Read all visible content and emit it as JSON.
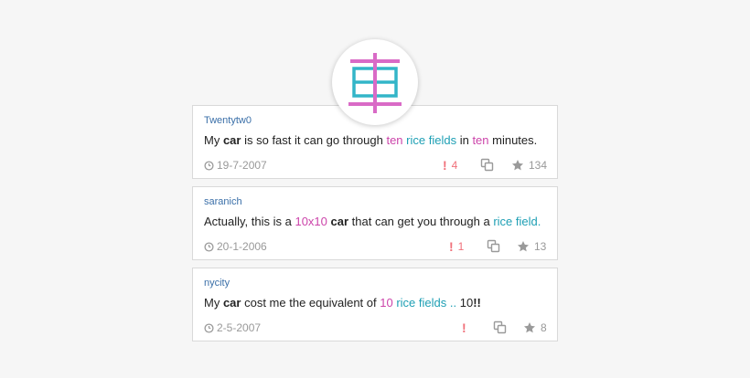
{
  "mnemonic": {
    "character": "車",
    "colors": {
      "pink": "#d96ac6",
      "teal": "#33b5c8"
    }
  },
  "mnemonics": [
    {
      "author": "Twentytw0",
      "sentence": [
        {
          "text": "My ",
          "style": "plain"
        },
        {
          "text": "car",
          "style": "kw"
        },
        {
          "text": " is so fast it can go through ",
          "style": "plain"
        },
        {
          "text": "ten",
          "style": "pk"
        },
        {
          "text": " ",
          "style": "plain"
        },
        {
          "text": "rice fields",
          "style": "tl"
        },
        {
          "text": " in ",
          "style": "plain"
        },
        {
          "text": "ten",
          "style": "pk"
        },
        {
          "text": " minutes.",
          "style": "plain"
        }
      ],
      "date": "19-7-2007",
      "reports": "4",
      "stars": "134"
    },
    {
      "author": "saranich",
      "sentence": [
        {
          "text": "Actually, this is a ",
          "style": "plain"
        },
        {
          "text": "10x10",
          "style": "pk"
        },
        {
          "text": " ",
          "style": "plain"
        },
        {
          "text": "car",
          "style": "kw"
        },
        {
          "text": " that can get you through a ",
          "style": "plain"
        },
        {
          "text": "rice field",
          "style": "tl"
        },
        {
          "text": ".",
          "style": "tl"
        }
      ],
      "date": "20-1-2006",
      "reports": "1",
      "stars": "13"
    },
    {
      "author": "nycity",
      "sentence": [
        {
          "text": "My ",
          "style": "plain"
        },
        {
          "text": "car",
          "style": "kw"
        },
        {
          "text": " cost me the equivalent of ",
          "style": "plain"
        },
        {
          "text": "10",
          "style": "pk"
        },
        {
          "text": " ",
          "style": "plain"
        },
        {
          "text": "rice fields",
          "style": "tl"
        },
        {
          "text": " .. ",
          "style": "tl"
        },
        {
          "text": "10",
          "style": "plain"
        },
        {
          "text": "!!",
          "style": "kw"
        }
      ],
      "date": "2-5-2007",
      "reports": "",
      "stars": "8"
    }
  ],
  "icons": {
    "date": "clock-icon",
    "report": "exclamation-icon",
    "copy": "copy-icon",
    "star": "star-icon"
  },
  "colors": {
    "author": "#3a6fa8",
    "pink": "#cc44aa",
    "teal": "#1e9fb4",
    "report": "#f0707a",
    "meta": "#999999"
  }
}
